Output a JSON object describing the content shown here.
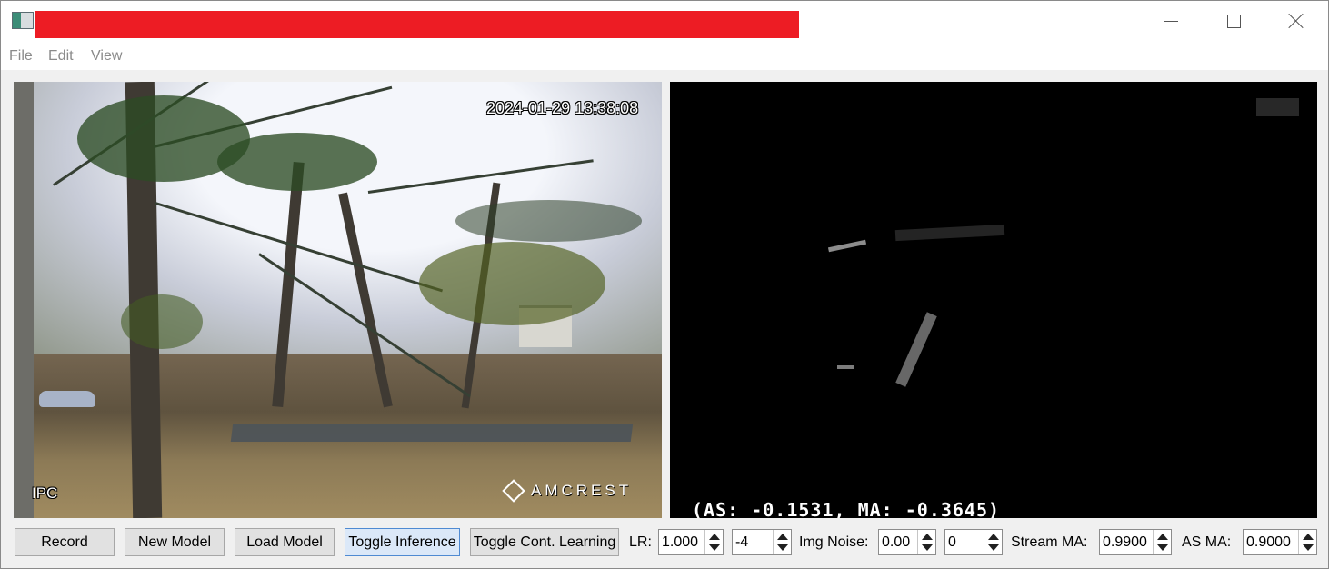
{
  "window": {
    "title": "",
    "menu": [
      "File",
      "Edit",
      "View"
    ]
  },
  "camera": {
    "timestamp": "2024-01-29 13:38:08",
    "overlay_label": "IPC",
    "brand": "AMCREST"
  },
  "inference": {
    "status": "(AS: -0.1531, MA: -0.3645)"
  },
  "controls": {
    "buttons": [
      "Record",
      "New Model",
      "Load Model",
      "Toggle Inference",
      "Toggle Cont. Learning"
    ],
    "lr_label": "LR:",
    "lr_value": "1.000",
    "lr_exponent": "-4",
    "img_noise_label": "Img Noise:",
    "img_noise_value": "0.00",
    "img_noise_extra": "0",
    "stream_ma_label": "Stream MA:",
    "stream_ma_value": "0.9900",
    "as_ma_label": "AS MA:",
    "as_ma_value": "0.9000"
  },
  "colors": {
    "redacted_title_bar": "#ed1c24",
    "active_button": "#4f8ad2"
  },
  "icons": [
    "app-icon",
    "minimize-icon",
    "maximize-icon",
    "close-icon",
    "arrow-up-icon",
    "arrow-down-icon"
  ]
}
